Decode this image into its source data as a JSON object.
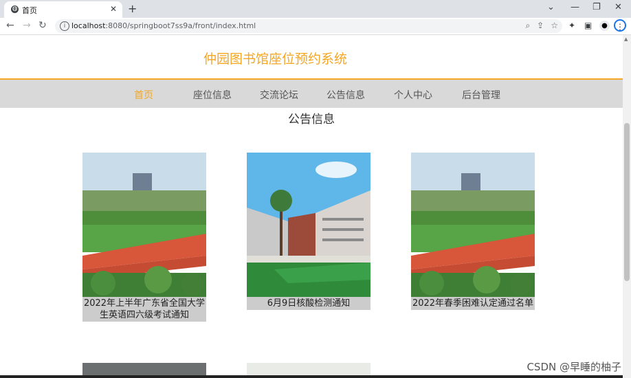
{
  "browser": {
    "tab_title": "首页",
    "new_tab": "+",
    "url_host": "localhost",
    "url_path": ":8080/springboot7ss9a/front/index.html"
  },
  "site": {
    "title": "仲园图书馆座位预约系统"
  },
  "nav": {
    "items": [
      {
        "label": "首页",
        "active": true
      },
      {
        "label": "座位信息",
        "active": false
      },
      {
        "label": "交流论坛",
        "active": false
      },
      {
        "label": "公告信息",
        "active": false
      },
      {
        "label": "个人中心",
        "active": false
      },
      {
        "label": "后台管理",
        "active": false
      }
    ]
  },
  "section": {
    "title": "公告信息"
  },
  "cards": [
    {
      "caption": "2022年上半年广东省全国大学生英语四六级考试通知",
      "image": "campus-sports-field"
    },
    {
      "caption": "6月9日核酸检测通知",
      "image": "campus-building"
    },
    {
      "caption": "2022年春季困难认定通过名单",
      "image": "campus-sports-field"
    }
  ],
  "watermark": "CSDN @早睡的柚子",
  "colors": {
    "accent": "#f5a623",
    "navbar_bg": "#d9d9d9",
    "caption_bg": "#cccccc"
  }
}
